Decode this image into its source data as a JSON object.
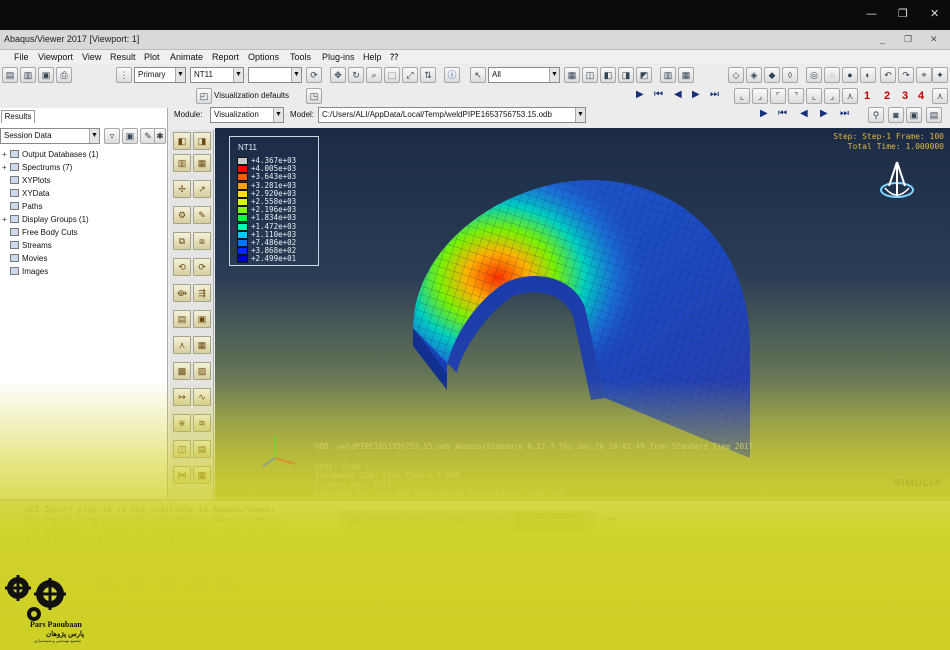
{
  "window": {
    "title": "Abaqus/Viewer 2017 [Viewport: 1]",
    "controls": [
      "—",
      "❐",
      "✕"
    ]
  },
  "menu": [
    "File",
    "Viewport",
    "View",
    "Result",
    "Plot",
    "Animate",
    "Report",
    "Options",
    "Tools",
    "Plug-ins",
    "Help",
    "⁇"
  ],
  "toolbar": {
    "primary_select": "Primary",
    "variable_select": "NT11",
    "section_select": "",
    "display_select": "All",
    "visualization_defaults": "Visualization defaults",
    "numbers": [
      "1",
      "2",
      "3",
      "4"
    ]
  },
  "context": {
    "module_label": "Module:",
    "module_value": "Visualization",
    "model_label": "Model:",
    "model_value": "C:/Users/ALI/AppData/Local/Temp/weldPIPE1653756753.15.odb"
  },
  "results_panel": {
    "tab": "Results",
    "session_select": "Session Data",
    "items": [
      {
        "label": "Output Databases (1)",
        "expandable": true
      },
      {
        "label": "Spectrums (7)",
        "expandable": true
      },
      {
        "label": "XYPlots",
        "expandable": false
      },
      {
        "label": "XYData",
        "expandable": false
      },
      {
        "label": "Paths",
        "expandable": false
      },
      {
        "label": "Display Groups (1)",
        "expandable": true
      },
      {
        "label": "Free Body Cuts",
        "expandable": false
      },
      {
        "label": "Streams",
        "expandable": false
      },
      {
        "label": "Movies",
        "expandable": false
      },
      {
        "label": "Images",
        "expandable": false
      }
    ]
  },
  "viewport": {
    "legend_title": "NT11",
    "legend_values": [
      "+4.367e+03",
      "+4.005e+03",
      "+3.643e+03",
      "+3.281e+03",
      "+2.920e+03",
      "+2.558e+03",
      "+2.196e+03",
      "+1.834e+03",
      "+1.472e+03",
      "+1.110e+03",
      "+7.486e+02",
      "+3.868e+02",
      "+2.499e+01"
    ],
    "legend_colors": [
      "#c8c8c8",
      "#ff0000",
      "#ff5a00",
      "#ffa300",
      "#ffe100",
      "#d8ff00",
      "#7cff00",
      "#00ff3c",
      "#00ffb4",
      "#00c8ff",
      "#0078ff",
      "#0028ff",
      "#0000c8"
    ],
    "step_line": "Step: Step-1    Frame: 100",
    "time_line": "Total Time: 1.000000",
    "odb_line": "ODB: weldPIPE1653756753.15.odb    Abaqus/Standard 6.12-3    Thu Jan 26 16:42:49 Iran Standard Time 2017",
    "step_detail": "Step: Step-1",
    "increment_line": "Increment   100: Step Time =   1.000",
    "primary_var": "Primary Var: NT11",
    "deformed_line": "Deformed Var: not set   Deformation Scale Factor: not set",
    "brand": "SIMULIA"
  },
  "messages": [
    "GUI Import plug-in is not available in Abaqus/Viewer",
    "GUI Import plug-in is not available in Abaqus/Viewer",
    "The database \"C:/Users/ALI/Desktop/New folder/weldPIPE",
    "A new \"odbUpdate\" \"C:/Users/ALI/AppData/Local/Temp/weldP..."
  ],
  "share_bar": {
    "text": "www.screencast-o-matic.com is sharing your screen.",
    "stop_label": "Stop sharing",
    "hide_label": "Hide"
  },
  "logo": {
    "brand_en": "Pars Paoubaan",
    "brand_fa": "پارس پژوهان",
    "subtitle": "مجتمع مهندسی و شبیه‌سازی"
  }
}
